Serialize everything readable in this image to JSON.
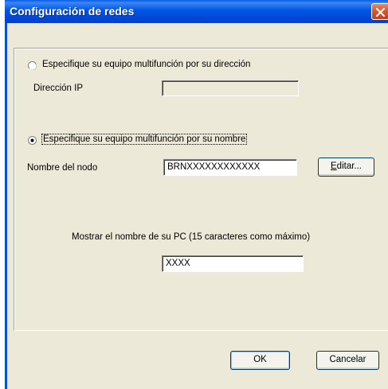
{
  "window": {
    "title": "Configuración de redes"
  },
  "option_address": {
    "label": "Especifique su equipo multifunción por su dirección",
    "selected": false
  },
  "ip_address": {
    "label": "Dirección IP",
    "value": ""
  },
  "option_name": {
    "label": "Especifique su equipo multifunción por su nombre",
    "selected": true
  },
  "node_name": {
    "label": "Nombre del nodo",
    "value": "BRNXXXXXXXXXXXX"
  },
  "edit_button": {
    "label": "Editar...",
    "mnemonic": "E",
    "rest": "ditar..."
  },
  "pc_name": {
    "label": "Mostrar el nombre de su PC (15 caracteres como máximo)",
    "value": "XXXX"
  },
  "buttons": {
    "ok": "OK",
    "cancel": "Cancelar"
  },
  "colors": {
    "titlebar": "#0055e5",
    "dialog_bg": "#ece9d8",
    "close": "#d9542c"
  }
}
